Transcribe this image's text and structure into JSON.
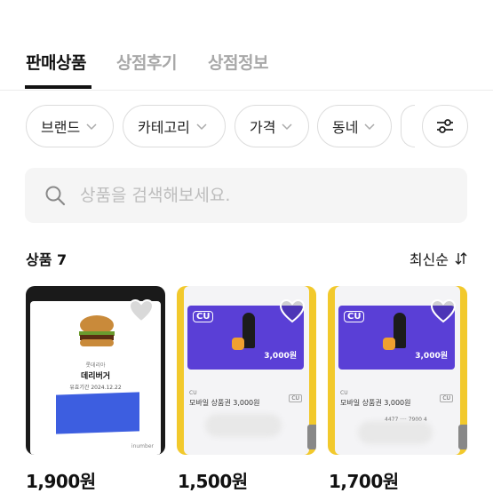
{
  "tabs": [
    {
      "label": "판매상품",
      "active": true
    },
    {
      "label": "상점후기",
      "active": false
    },
    {
      "label": "상점정보",
      "active": false
    }
  ],
  "filters": [
    "브랜드",
    "카테고리",
    "가격",
    "동네"
  ],
  "search": {
    "placeholder": "상품을 검색해보세요."
  },
  "products_header": {
    "count_label": "상품 7",
    "sort_label": "최신순"
  },
  "products": [
    {
      "price": "1,900원",
      "card_brand": "롯데리아",
      "card_item": "데리버거",
      "card_validity": "유효기간 2024.12.22",
      "card_footer": "inumber"
    },
    {
      "price": "1,500원",
      "card_logo": "CU",
      "card_amount": "3,000원",
      "card_brand": "CU",
      "card_title": "모바일 상품권 3,000원",
      "card_tag": "CU"
    },
    {
      "price": "1,700원",
      "card_logo": "CU",
      "card_amount": "3,000원",
      "card_brand": "CU",
      "card_title": "모바일 상품권 3,000원",
      "card_tag": "CU",
      "card_code": "4477 ···· 7900 4"
    }
  ],
  "colors": {
    "accent": "#111111",
    "cu_purple": "#5a3fd6",
    "yellow_frame": "#f2c92c",
    "blur_blue": "#3b5bd9"
  }
}
